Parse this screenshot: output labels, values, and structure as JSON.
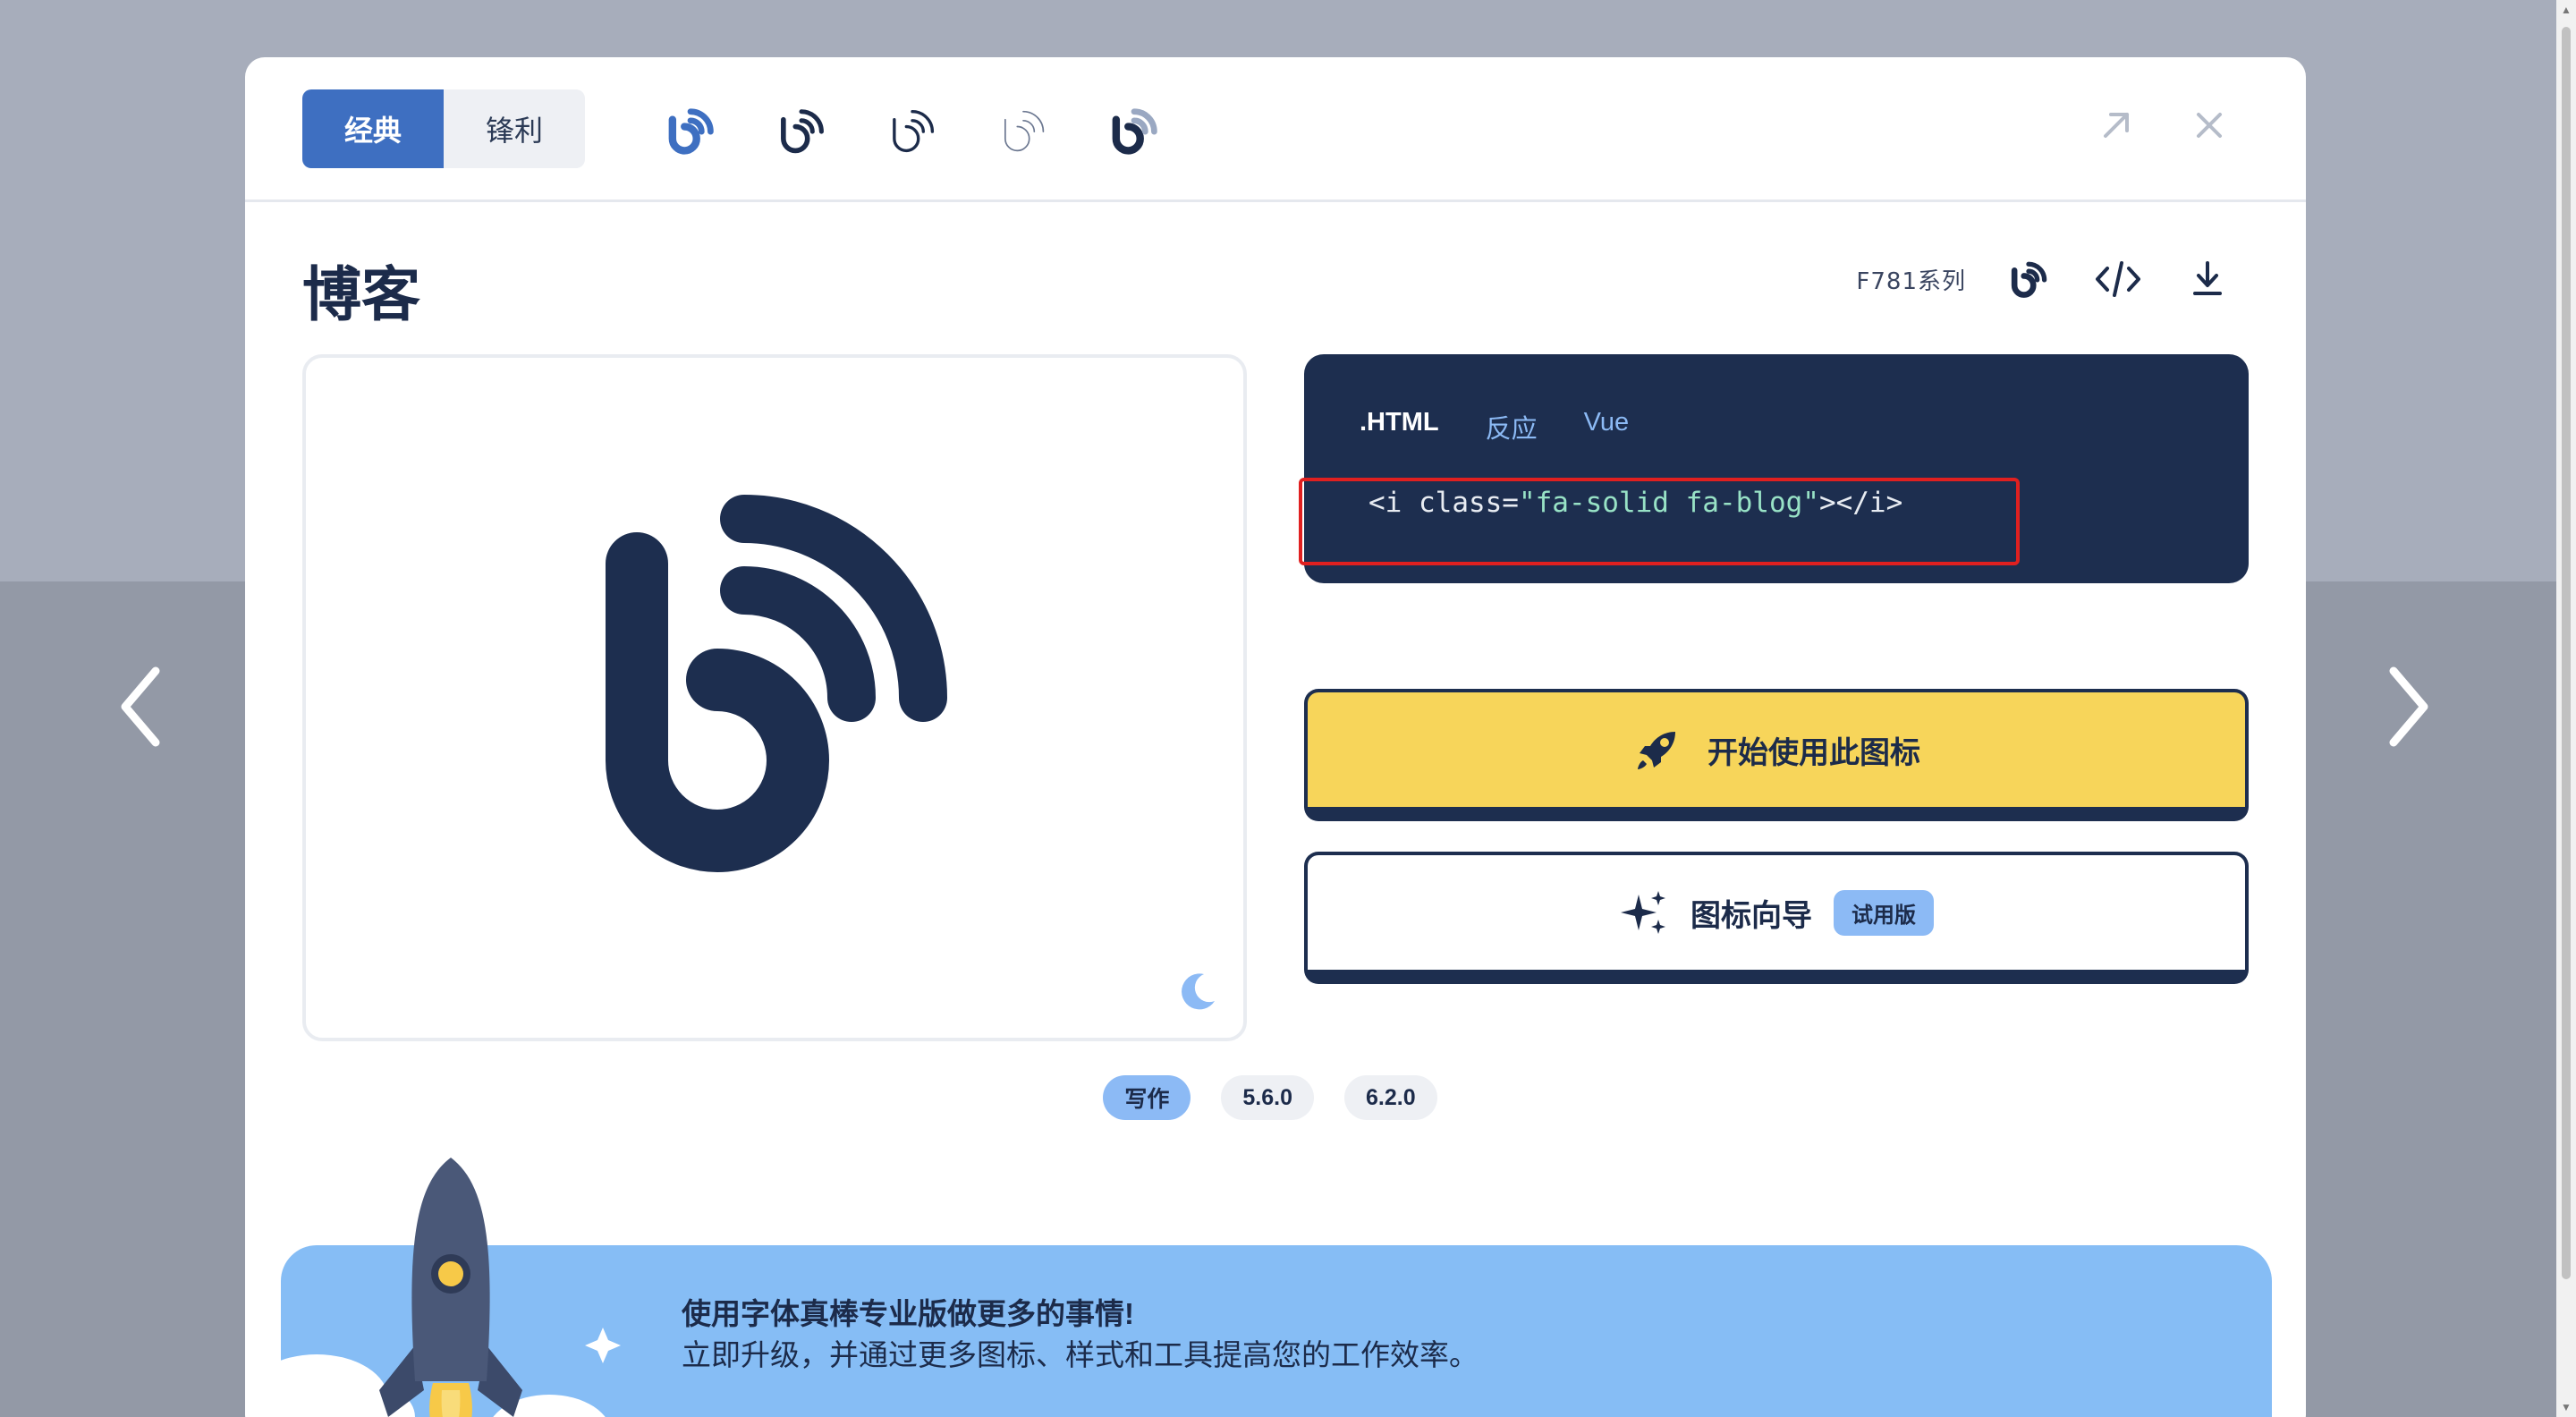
{
  "header": {
    "style_tabs": [
      "经典",
      "锋利"
    ],
    "active_style": "经典",
    "variant_icons": [
      "blog-solid-icon",
      "blog-regular-icon",
      "blog-light-icon",
      "blog-thin-icon",
      "blog-duotone-icon"
    ],
    "actions": [
      "expand-icon",
      "close-icon"
    ]
  },
  "icon": {
    "title": "博客",
    "unicode_label": "F781系列"
  },
  "code": {
    "tabs": [
      ".HTML",
      "反应",
      "Vue"
    ],
    "active_tab": ".HTML",
    "snippet_open": "<i class=",
    "snippet_value": "\"fa-solid fa-blog\"",
    "snippet_close": "></i>"
  },
  "buttons": {
    "start_label": "开始使用此图标",
    "wizard_label": "图标向导",
    "trial_badge": "试用版"
  },
  "tags": {
    "category": "写作",
    "versions": [
      "5.6.0",
      "6.2.0"
    ]
  },
  "promo": {
    "title": "使用字体真棒专业版做更多的事情!",
    "text": "立即升级，并通过更多图标、样式和工具提高您的工作效率。"
  },
  "colors": {
    "navy": "#1d2e4f",
    "brand_blue": "#3e6fc1",
    "yellow": "#f7d55a",
    "light_blue": "#86bdf5",
    "highlight_red": "#e02020"
  }
}
